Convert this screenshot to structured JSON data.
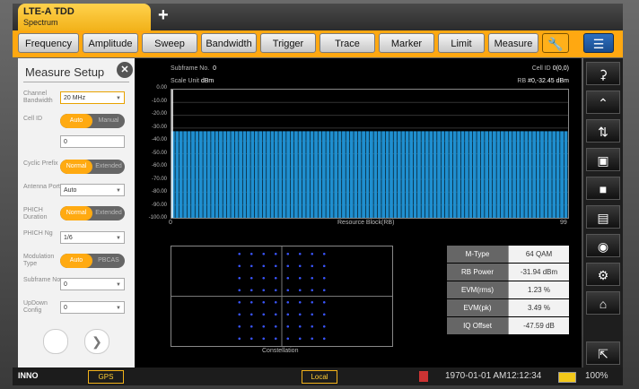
{
  "mode_tab": {
    "title": "LTE-A TDD",
    "subtitle": "Spectrum"
  },
  "add_tab": "+",
  "menu": [
    "Frequency",
    "Amplitude",
    "Sweep",
    "Bandwidth",
    "Trigger",
    "Trace",
    "Marker",
    "Limit",
    "Measure"
  ],
  "left_panel": {
    "title": "Measure Setup",
    "channel_bandwidth": {
      "label": "Channel Bandwidth",
      "value": "20 MHz"
    },
    "cell_id": {
      "label": "Cell ID",
      "on": "Auto",
      "off": "Manual",
      "value": "0"
    },
    "cyclic_prefix": {
      "label": "Cyclic Prefix",
      "on": "Normal",
      "off": "Extended"
    },
    "antenna_port": {
      "label": "Antenna Port",
      "value": "Auto"
    },
    "phich_duration": {
      "label": "PHICH Duration",
      "on": "Normal",
      "off": "Extended"
    },
    "phich_ng": {
      "label": "PHICH Ng",
      "value": "1/6"
    },
    "modulation_type": {
      "label": "Modulation Type",
      "on": "Auto",
      "off": "PBCAS"
    },
    "subframe_no": {
      "label": "Subframe No",
      "value": "0"
    },
    "updown_config": {
      "label": "UpDown Config",
      "value": "0"
    }
  },
  "display": {
    "subframe_label": "Subframe No.",
    "subframe_value": "0",
    "scale_label": "Scale Unit",
    "scale_value": "dBm",
    "cell_id_label": "Cell ID",
    "cell_id_value": "0(0,0)",
    "rb_label": "RB",
    "rb_value": "#0,-32.45 dBm",
    "y_ticks": [
      "0.00",
      "-10.00",
      "-20.00",
      "-30.00",
      "-40.00",
      "-50.00",
      "-60.00",
      "-70.00",
      "-80.00",
      "-90.00",
      "-100.00"
    ],
    "x_start": "0",
    "x_end": "99",
    "x_axis_label": "Resource Block(RB)",
    "constellation_label": "Constellation"
  },
  "chart_data": {
    "type": "bar",
    "xlabel": "Resource Block(RB)",
    "ylabel": "",
    "ylim": [
      -100,
      0
    ],
    "xlim": [
      0,
      99
    ],
    "bar_count": 100,
    "bar_value_dBm": -32.45,
    "bar_color": "#1f8fd0"
  },
  "measurements": [
    {
      "key": "M-Type",
      "value": "64 QAM"
    },
    {
      "key": "RB Power",
      "value": "-31.94 dBm"
    },
    {
      "key": "EVM(rms)",
      "value": "1.23 %"
    },
    {
      "key": "EVM(pk)",
      "value": "3.49 %"
    },
    {
      "key": "IQ Offset",
      "value": "-47.59 dB"
    }
  ],
  "status": {
    "logo": "INNO",
    "gps": "GPS",
    "local": "Local",
    "datetime": "1970-01-01  AM12:12:34",
    "battery": "100%"
  },
  "colors": {
    "accent": "#ffa811",
    "trace": "#1f8fd0",
    "const_dot": "#3a55ff"
  }
}
